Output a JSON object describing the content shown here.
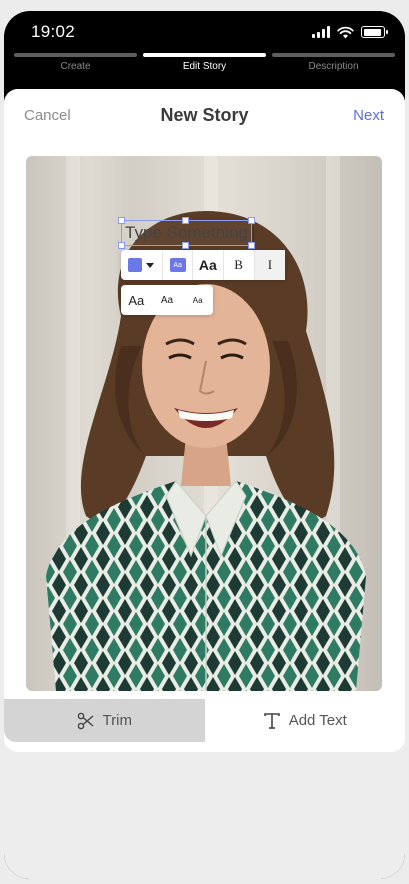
{
  "status_bar": {
    "time": "19:02"
  },
  "steps": [
    {
      "label": "Create",
      "active": false
    },
    {
      "label": "Edit Story",
      "active": true
    },
    {
      "label": "Description",
      "active": false
    }
  ],
  "header": {
    "cancel": "Cancel",
    "title": "New Story",
    "next": "Next"
  },
  "editor": {
    "text_placeholder": "Type Something",
    "text_color": "#6b78e6",
    "style_buttons": {
      "bold": "B",
      "italic": "I"
    },
    "size_label": "Aa",
    "sizes": [
      "Aa",
      "Aa",
      "Aa"
    ]
  },
  "tabs": [
    {
      "label": "Trim",
      "icon": "scissors-icon",
      "active": true
    },
    {
      "label": "Add Text",
      "icon": "text-icon",
      "active": false
    }
  ],
  "colors": {
    "accent": "#5a6fde",
    "swatch": "#6b78e6"
  }
}
